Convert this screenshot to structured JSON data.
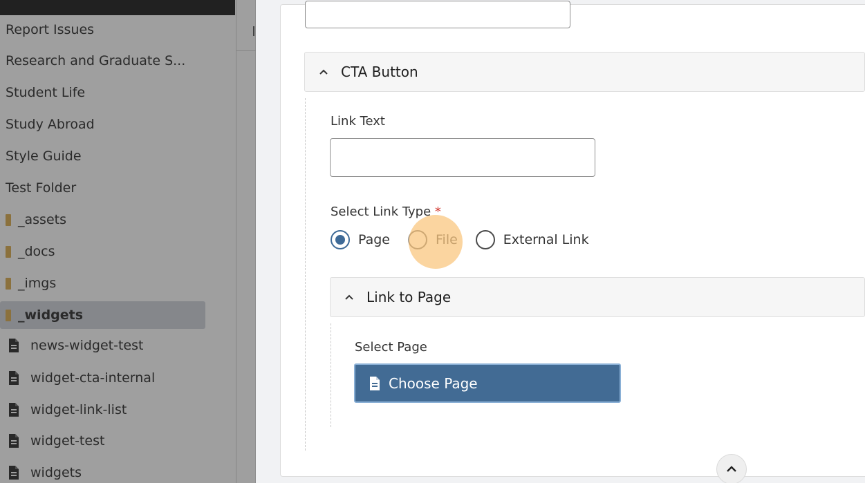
{
  "sidebar": {
    "items": [
      {
        "label": "Report Issues",
        "kind": "text"
      },
      {
        "label": "Research and Graduate S...",
        "kind": "text"
      },
      {
        "label": "Student Life",
        "kind": "text"
      },
      {
        "label": "Study Abroad",
        "kind": "text"
      },
      {
        "label": "Style Guide",
        "kind": "text"
      },
      {
        "label": "Test Folder",
        "kind": "text"
      },
      {
        "label": "_assets",
        "kind": "folder"
      },
      {
        "label": "_docs",
        "kind": "folder"
      },
      {
        "label": "_imgs",
        "kind": "folder"
      },
      {
        "label": "_widgets",
        "kind": "folder",
        "selected": true
      },
      {
        "label": "news-widget-test",
        "kind": "page"
      },
      {
        "label": "widget-cta-internal",
        "kind": "page"
      },
      {
        "label": "widget-link-list",
        "kind": "page"
      },
      {
        "label": "widget-test",
        "kind": "page"
      },
      {
        "label": "widgets",
        "kind": "page"
      }
    ]
  },
  "form": {
    "cta_section_title": "CTA Button",
    "link_text_label": "Link Text",
    "link_text_value": "",
    "link_type_label": "Select Link Type",
    "required_marker": "*",
    "link_type_options": [
      {
        "label": "Page",
        "checked": true
      },
      {
        "label": "File",
        "checked": false
      },
      {
        "label": "External Link",
        "checked": false
      }
    ],
    "link_to_page_title": "Link to Page",
    "select_page_label": "Select Page",
    "choose_page_button": "Choose Page"
  },
  "colors": {
    "primary": "#426b94",
    "radio_checked": "#3e6a97",
    "required": "#d0342c",
    "folder": "#d2a64c",
    "click_highlight": "#f7b352"
  },
  "icons": {
    "accordion_toggle": "chevron-up-icon",
    "page_item": "file-text-icon",
    "folder_item": "folder-icon",
    "scroll_top": "chevron-up-icon"
  }
}
